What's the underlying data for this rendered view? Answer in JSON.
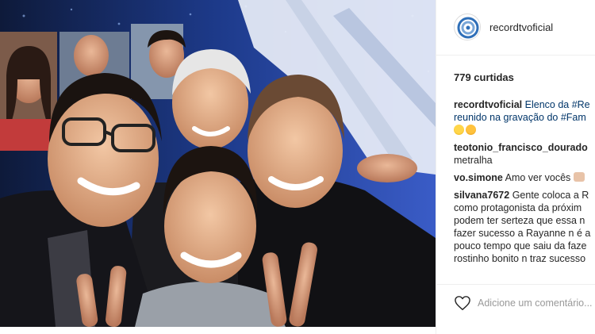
{
  "post": {
    "photo_alt": "",
    "account": {
      "username": "recordtvoficial",
      "avatar_icon": "recordtv-logo-icon"
    },
    "likes_label": "779 curtidas",
    "comments": [
      {
        "username": "recordtvoficial",
        "lines": [
          "Elenco da #Re",
          "reunido na gravação do #Fam"
        ],
        "emojis": [
          "heart-eyes-emoji",
          "astonished-emoji"
        ]
      },
      {
        "username": "teotonio_francisco_dourado",
        "lines": [
          "metralha"
        ]
      },
      {
        "username": "vo.simone",
        "lines": [
          "Amo ver vocês"
        ],
        "emoji_after": "clapping-hands-emoji"
      },
      {
        "username": "silvana7672",
        "lines": [
          "Gente coloca a R",
          "como protagonista da próxim",
          "podem ter serteza que essa n",
          "fazer sucesso a Rayanne n é a",
          "pouco tempo que saiu da faze",
          "rostinho bonito n traz sucesso"
        ]
      }
    ],
    "comment_box": {
      "placeholder": "Adicione um comentário..."
    },
    "colors": {
      "text": "#262626",
      "hashtag": "#003569",
      "divider": "#efefef",
      "placeholder": "#999999"
    }
  }
}
